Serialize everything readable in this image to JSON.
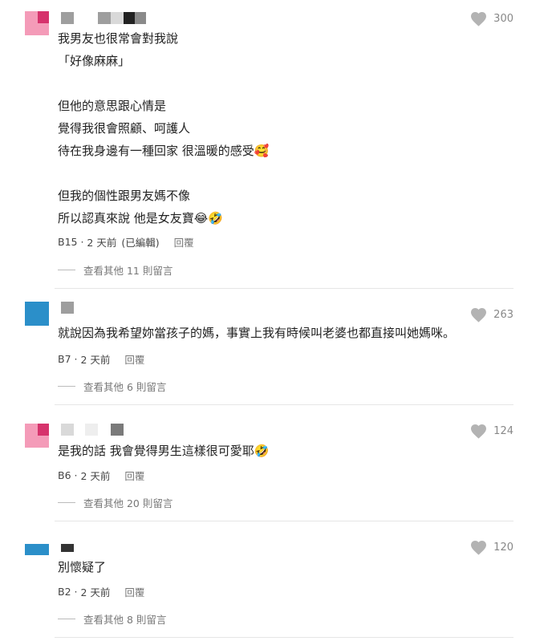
{
  "comments": [
    {
      "avatar_colors": [
        "#f49bb8",
        "#d6336c"
      ],
      "like_count": "300",
      "text": "我男友也很常會對我說\n「好像麻麻」\n\n但他的意思跟心情是\n覺得我很會照顧、呵護人\n待在我身邊有一種回家 很溫暖的感受🥰\n\n但我的個性跟男友媽不像\n所以認真來說 他是女友寶😂🤣",
      "floor": "B15",
      "time": "2 天前",
      "edited": "(已編輯)",
      "reply": "回覆",
      "more": "查看其他 11 則留言"
    },
    {
      "avatar_colors": [
        "#2b8fc9"
      ],
      "like_count": "263",
      "text": "就說因為我希望妳當孩子的媽，事實上我有時候叫老婆也都直接叫她媽咪。",
      "floor": "B7",
      "time": "2 天前",
      "edited": "",
      "reply": "回覆",
      "more": "查看其他 6 則留言"
    },
    {
      "avatar_colors": [
        "#f49bb8",
        "#d6336c"
      ],
      "like_count": "124",
      "text": "是我的話 我會覺得男生這樣很可愛耶🤣",
      "floor": "B6",
      "time": "2 天前",
      "edited": "",
      "reply": "回覆",
      "more": "查看其他 20 則留言"
    },
    {
      "avatar_colors": [
        "#2b8fc9"
      ],
      "like_count": "120",
      "text": "別懷疑了",
      "floor": "B2",
      "time": "2 天前",
      "edited": "",
      "reply": "回覆",
      "more": "查看其他 8 則留言"
    }
  ],
  "icons": {
    "like": "heart-icon"
  },
  "colors": {
    "heart": "#b3b3b3",
    "divider": "#e6e6e6",
    "meta_text": "#444444"
  }
}
